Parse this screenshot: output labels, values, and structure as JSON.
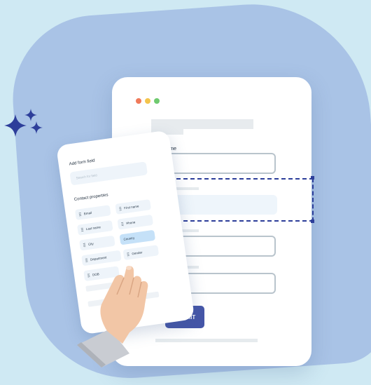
{
  "colors": {
    "background": "#cfe9f3",
    "blob": "#a9c3e6",
    "sparkle": "#2d3e9a",
    "accent": "#4556a8",
    "dashed_outline": "#2d3e9a",
    "traffic_lights": [
      "#f07a5a",
      "#f3c44c",
      "#6fca6f"
    ]
  },
  "form": {
    "first_name_label": "First name",
    "submit_label": "SUBMIT"
  },
  "panel": {
    "add_field_title": "Add form field",
    "search_placeholder": "Search for field",
    "section_title": "Contact properties",
    "chips": [
      {
        "label": "Email"
      },
      {
        "label": "First name"
      },
      {
        "label": "Last name"
      },
      {
        "label": "Phone"
      },
      {
        "label": "City"
      },
      {
        "label": "Country",
        "active": true
      },
      {
        "label": "Department"
      },
      {
        "label": "Gender"
      },
      {
        "label": "DOB"
      }
    ]
  },
  "icons": [
    "sparkle-icon",
    "drag-handle-icon",
    "pointing-hand-icon"
  ]
}
